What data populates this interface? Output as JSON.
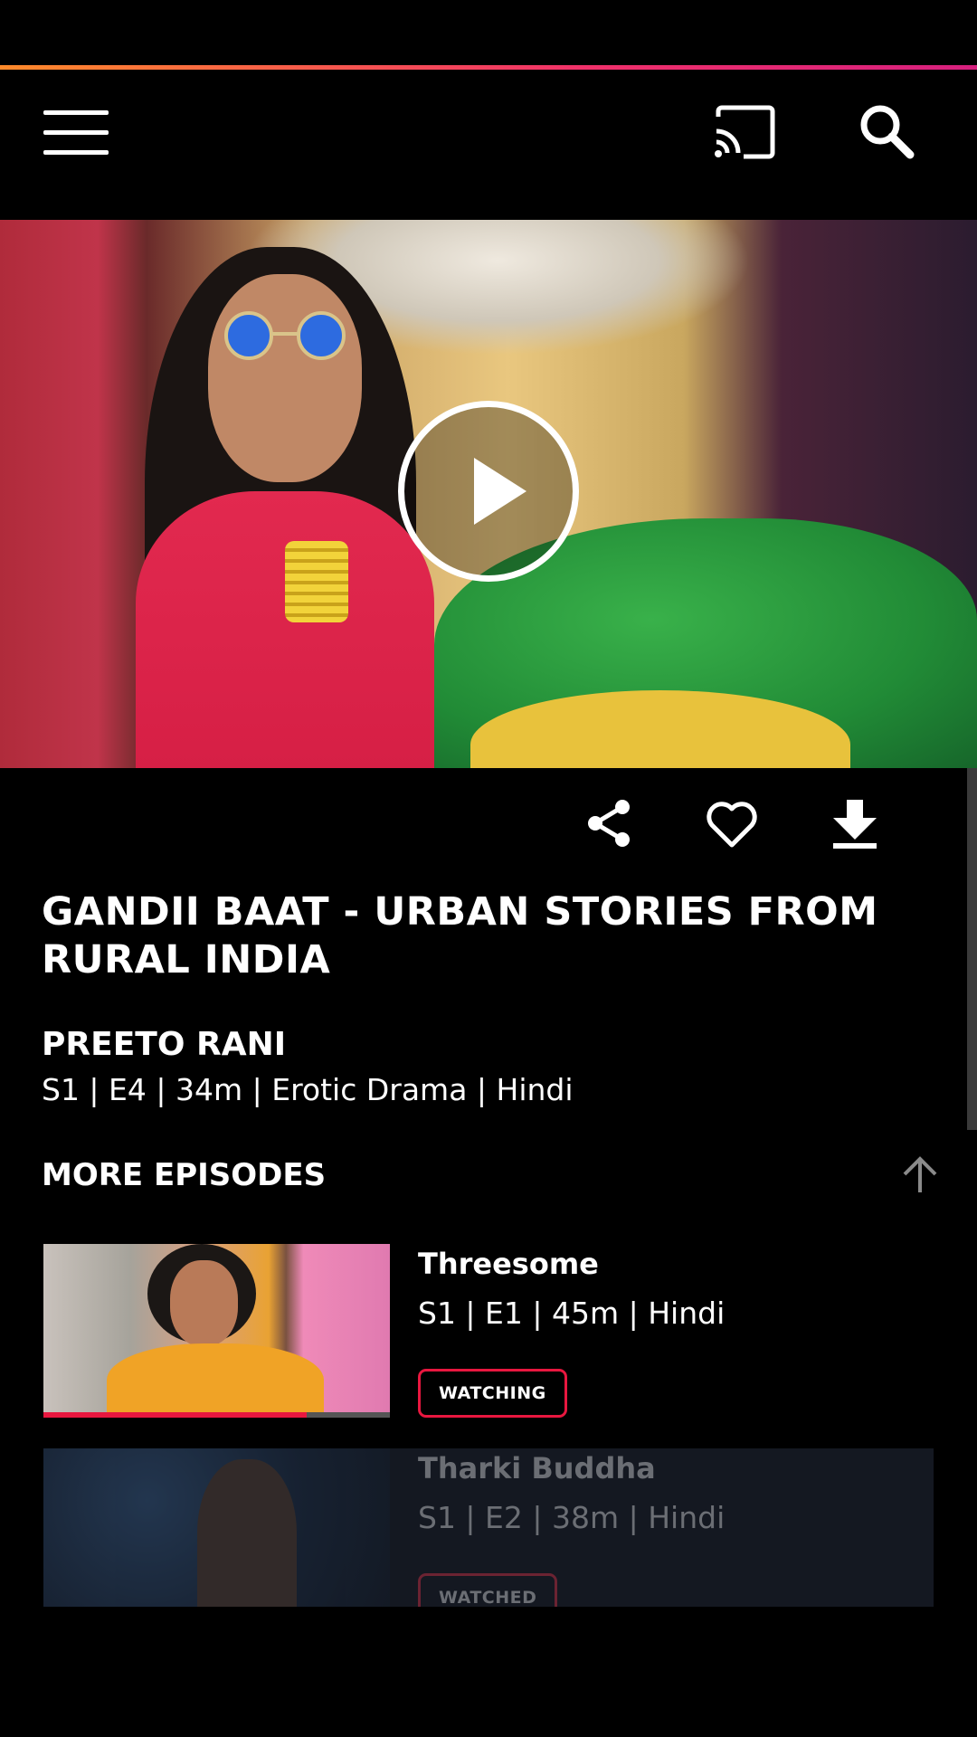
{
  "colors": {
    "accent": "#e8173f",
    "background": "#000000",
    "gradient_start": "#ff8a2a",
    "gradient_end": "#d6207e"
  },
  "header": {
    "menu_icon": "hamburger-menu-icon",
    "cast_icon": "cast-icon",
    "search_icon": "search-icon"
  },
  "hero": {
    "play_icon": "play-icon"
  },
  "actions": {
    "share_icon": "share-icon",
    "favorite_icon": "heart-icon",
    "download_icon": "download-icon"
  },
  "show": {
    "title": "GANDII BAAT - URBAN STORIES FROM RURAL INDIA",
    "episode_title": "PREETO RANI",
    "episode_meta": "S1 | E4 | 34m | Erotic Drama | Hindi"
  },
  "more_episodes": {
    "heading": "MORE EPISODES",
    "scroll_up_icon": "arrow-up-icon",
    "items": [
      {
        "name": "Threesome",
        "meta": "S1 | E1 | 45m | Hindi",
        "status": "WATCHING",
        "progress": 0.76
      },
      {
        "name": "Tharki Buddha",
        "meta": "S1 | E2 | 38m | Hindi",
        "status": "WATCHED"
      }
    ]
  }
}
